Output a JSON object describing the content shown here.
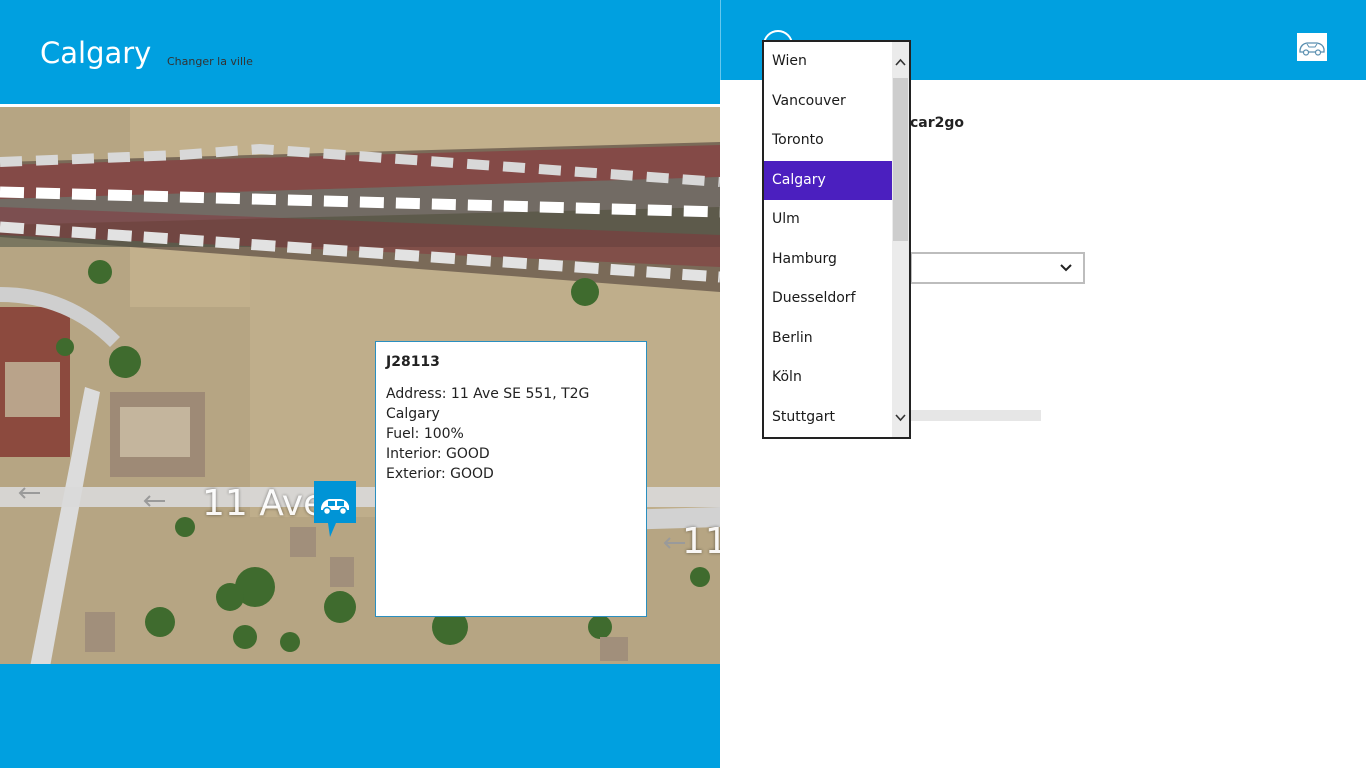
{
  "header": {
    "city_title": "Calgary",
    "change_city_label": "Changer la ville"
  },
  "map": {
    "street_label_main": "11 Ave",
    "street_label_right": "11"
  },
  "popup": {
    "car_id": "J28113",
    "address": "Address: 11 Ave SE 551, T2G Calgary",
    "fuel": "Fuel: 100%",
    "interior": "Interior: GOOD",
    "exterior": "Exterior: GOOD"
  },
  "settings": {
    "provider_label": "car2go"
  },
  "city_dropdown": {
    "options": [
      "Wien",
      "Vancouver",
      "Toronto",
      "Calgary",
      "Ulm",
      "Hamburg",
      "Duesseldorf",
      "Berlin",
      "Köln",
      "Stuttgart"
    ],
    "selected": "Calgary"
  },
  "icons": {
    "car_pin": "car-icon",
    "app_logo": "car-logo-icon",
    "back": "back-arrow-icon"
  },
  "colors": {
    "accent": "#00a0e0",
    "selection": "#4b1fbf"
  }
}
